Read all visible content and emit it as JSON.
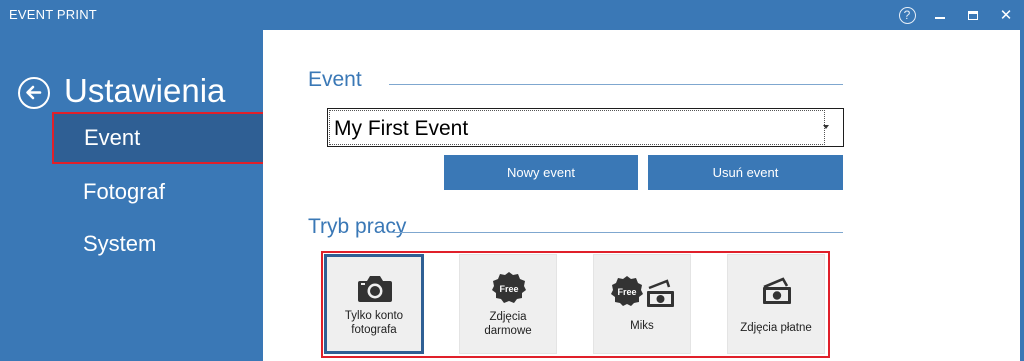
{
  "window": {
    "title": "EVENT PRINT",
    "help_glyph": "?",
    "close_glyph": "✕"
  },
  "sidebar": {
    "title": "Ustawienia",
    "items": [
      {
        "label": "Event",
        "selected": true
      },
      {
        "label": "Fotograf",
        "selected": false
      },
      {
        "label": "System",
        "selected": false
      }
    ]
  },
  "event_section": {
    "title": "Event",
    "selected_event": "My First Event",
    "new_button": "Nowy event",
    "delete_button": "Usuń event"
  },
  "mode_section": {
    "title": "Tryb pracy",
    "modes": [
      {
        "label_line1": "Tylko konto",
        "label_line2": "fotografa",
        "icon": "camera-icon",
        "selected": true
      },
      {
        "label_line1": "Zdjęcia",
        "label_line2": "darmowe",
        "icon": "free-badge-icon",
        "badge_text": "Free",
        "selected": false
      },
      {
        "label_line1": "Miks",
        "label_line2": "",
        "icon": "free-and-money-icon",
        "badge_text": "Free",
        "selected": false
      },
      {
        "label_line1": "Zdjęcia płatne",
        "label_line2": "",
        "icon": "money-icon",
        "selected": false
      }
    ]
  },
  "colors": {
    "accent": "#3a78b6",
    "selected_nav": "#2f5f94",
    "highlight_border": "#e0202a"
  }
}
